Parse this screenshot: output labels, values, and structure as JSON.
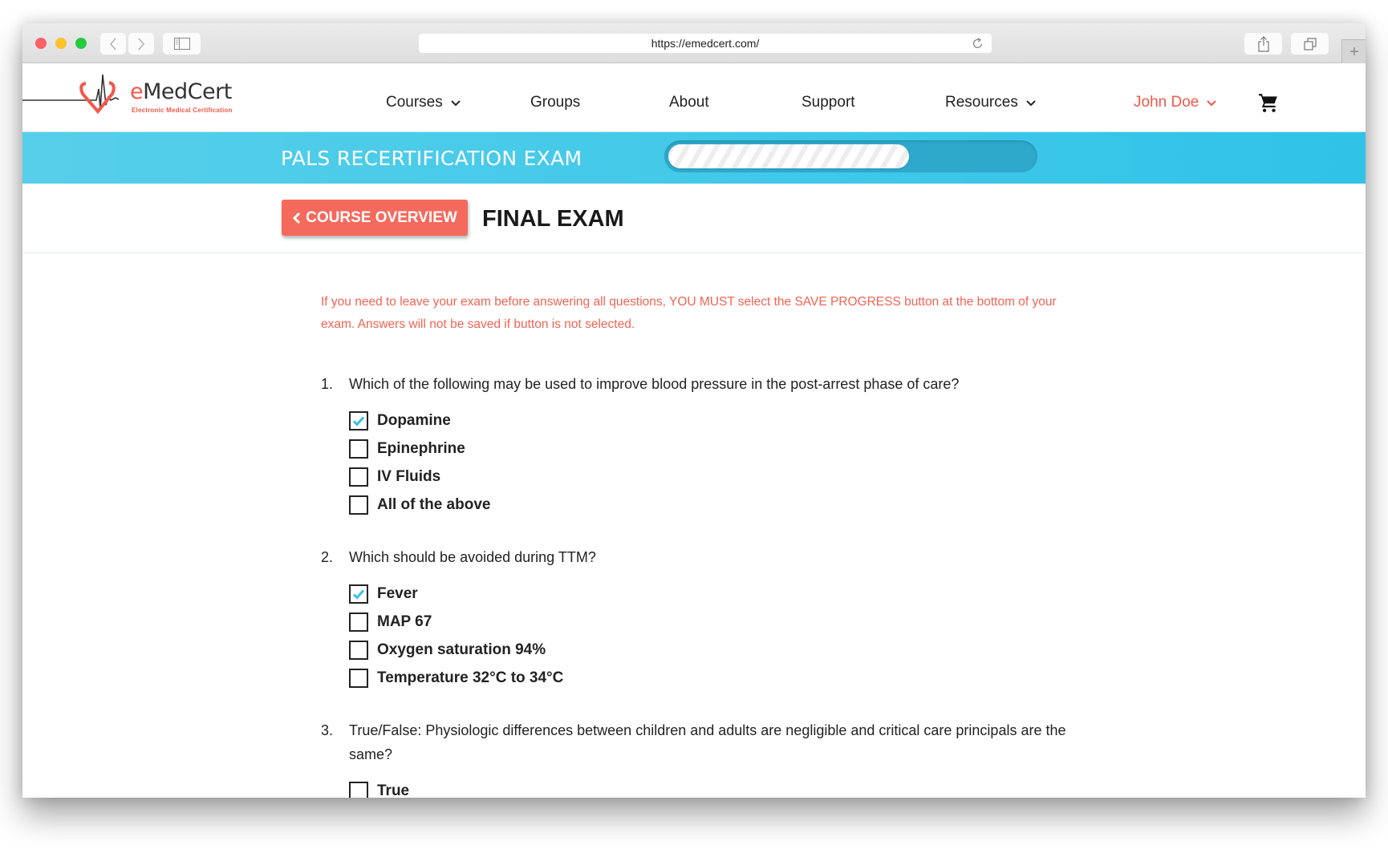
{
  "browser": {
    "url": "https://emedcert.com/",
    "new_tab_label": "+"
  },
  "logo": {
    "name_prefix": "e",
    "name_rest": "MedCert",
    "tagline": "Electronic Medical Certification"
  },
  "nav": {
    "items": [
      {
        "label": "Courses",
        "has_dropdown": true
      },
      {
        "label": "Groups",
        "has_dropdown": false
      },
      {
        "label": "About",
        "has_dropdown": false
      },
      {
        "label": "Support",
        "has_dropdown": false
      },
      {
        "label": "Resources",
        "has_dropdown": true
      }
    ],
    "user": {
      "label": "John Doe",
      "has_dropdown": true
    },
    "cart_icon": "shopping-cart-icon"
  },
  "banner": {
    "title": "PALS RECERTIFICATION EXAM",
    "progress_percent": 66
  },
  "header": {
    "back_button_label": "COURSE OVERVIEW",
    "title": "FINAL EXAM"
  },
  "notice": "If you need to leave your exam before answering all questions, YOU MUST select the SAVE PROGRESS button at the bottom of your exam. Answers will not be saved if button is not selected.",
  "questions": [
    {
      "number": "1.",
      "text": "Which of the following may be used to improve blood pressure in the post-arrest phase of care?",
      "options": [
        {
          "label": "Dopamine",
          "checked": true
        },
        {
          "label": "Epinephrine",
          "checked": false
        },
        {
          "label": "IV Fluids",
          "checked": false
        },
        {
          "label": "All of the above",
          "checked": false
        }
      ]
    },
    {
      "number": "2.",
      "text": "Which should be avoided during TTM?",
      "options": [
        {
          "label": "Fever",
          "checked": true
        },
        {
          "label": "MAP 67",
          "checked": false
        },
        {
          "label": "Oxygen saturation 94%",
          "checked": false
        },
        {
          "label": "Temperature 32°C to 34°C",
          "checked": false
        }
      ]
    },
    {
      "number": "3.",
      "text": "True/False: Physiologic differences between children and adults are negligible and critical care principals are the same?",
      "options": [
        {
          "label": "True",
          "checked": false
        }
      ]
    }
  ],
  "colors": {
    "accent_red": "#f46a5c",
    "banner_blue": "#33c3e6",
    "check_blue": "#3bbde6"
  }
}
